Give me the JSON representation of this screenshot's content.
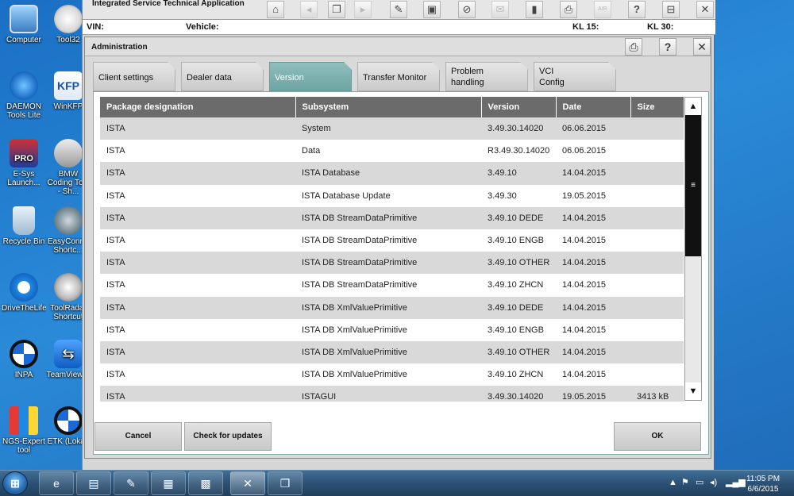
{
  "desktop_icons": [
    {
      "label": "Computer"
    },
    {
      "label": "Tool32"
    },
    {
      "label": "DAEMON Tools Lite"
    },
    {
      "label": "WinKFP"
    },
    {
      "label": "E-Sys Launch..."
    },
    {
      "label": "BMW Coding Tool - Sh..."
    },
    {
      "label": "Recycle Bin"
    },
    {
      "label": "EasyConn - Shortc..."
    },
    {
      "label": "DriveTheLife"
    },
    {
      "label": "ToolRadar Shortcut"
    },
    {
      "label": "INPA"
    },
    {
      "label": "TeamViewer"
    },
    {
      "label": "NGS-Expert tool"
    },
    {
      "label": "ETK (Lokal)"
    }
  ],
  "window": {
    "title": "Integrated Service Technical Application",
    "vin_label": "VIN:",
    "vehicle_label": "Vehicle:",
    "kl15_label": "KL 15:",
    "kl30_label": "KL 30:"
  },
  "toolbar_icons": [
    "home-icon",
    "back-icon",
    "copy-icon",
    "forward-icon",
    "wrench-icon",
    "display-icon",
    "measure-icon",
    "mail-icon",
    "battery-icon",
    "print-icon",
    "air-icon",
    "help-icon",
    "info-icon",
    "close-icon"
  ],
  "toolbar_text": {
    "air": "AIR"
  },
  "dialog": {
    "title": "Administration",
    "tabs": [
      {
        "label": "Client settings",
        "line2": ""
      },
      {
        "label": "Dealer data",
        "line2": ""
      },
      {
        "label": "Version",
        "line2": ""
      },
      {
        "label": "Transfer Monitor",
        "line2": ""
      },
      {
        "label": "Problem",
        "line2": "handling"
      },
      {
        "label": "VCI",
        "line2": "Config"
      }
    ],
    "columns": [
      "Package designation",
      "Subsystem",
      "Version",
      "Date",
      "Size"
    ],
    "rows": [
      [
        "ISTA",
        "System",
        "3.49.30.14020",
        "06.06.2015",
        ""
      ],
      [
        "ISTA",
        "Data",
        "R3.49.30.14020",
        "06.06.2015",
        ""
      ],
      [
        "ISTA",
        "ISTA Database",
        "3.49.10",
        "14.04.2015",
        ""
      ],
      [
        "ISTA",
        "ISTA Database Update",
        "3.49.30",
        "19.05.2015",
        ""
      ],
      [
        "ISTA",
        "ISTA DB StreamDataPrimitive",
        "3.49.10 DEDE",
        "14.04.2015",
        ""
      ],
      [
        "ISTA",
        "ISTA DB StreamDataPrimitive",
        "3.49.10 ENGB",
        "14.04.2015",
        ""
      ],
      [
        "ISTA",
        "ISTA DB StreamDataPrimitive",
        "3.49.10 OTHER",
        "14.04.2015",
        ""
      ],
      [
        "ISTA",
        "ISTA DB StreamDataPrimitive",
        "3.49.10 ZHCN",
        "14.04.2015",
        ""
      ],
      [
        "ISTA",
        "ISTA DB XmlValuePrimitive",
        "3.49.10 DEDE",
        "14.04.2015",
        ""
      ],
      [
        "ISTA",
        "ISTA DB XmlValuePrimitive",
        "3.49.10 ENGB",
        "14.04.2015",
        ""
      ],
      [
        "ISTA",
        "ISTA DB XmlValuePrimitive",
        "3.49.10 OTHER",
        "14.04.2015",
        ""
      ],
      [
        "ISTA",
        "ISTA DB XmlValuePrimitive",
        "3.49.10 ZHCN",
        "14.04.2015",
        ""
      ],
      [
        "ISTA",
        "ISTAGUI",
        "3.49.30.14020",
        "19.05.2015",
        "3413 kB"
      ]
    ],
    "buttons": {
      "cancel": "Cancel",
      "check": "Check for updates",
      "ok": "OK"
    }
  },
  "taskbar": {
    "clock_time": "11:05 PM",
    "clock_date": "6/6/2015"
  }
}
